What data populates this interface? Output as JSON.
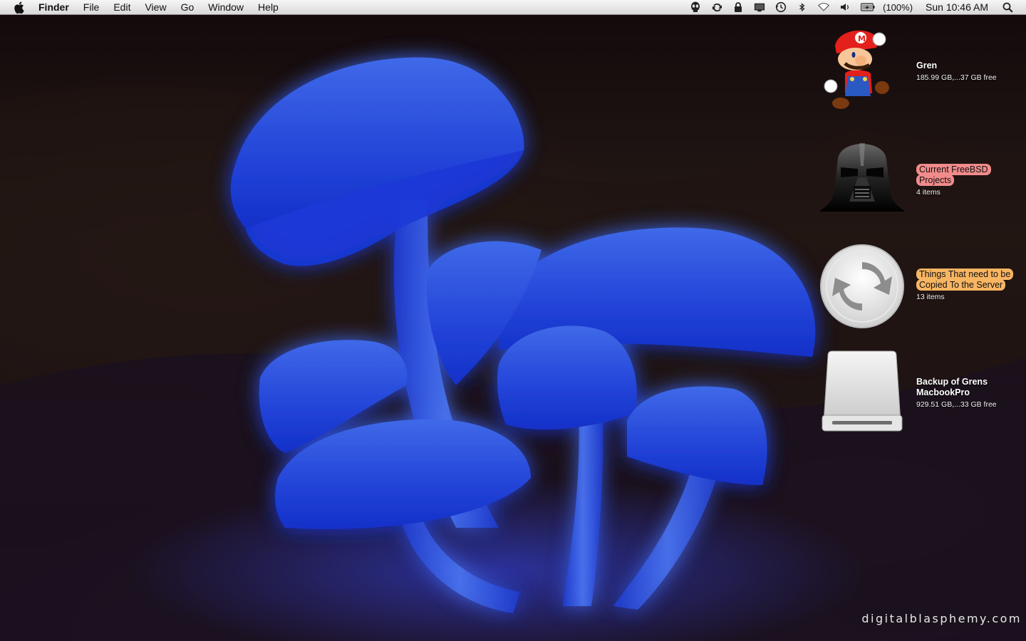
{
  "menubar": {
    "apple_icon": "apple-logo-icon",
    "app_name": "Finder",
    "menus": [
      "File",
      "Edit",
      "View",
      "Go",
      "Window",
      "Help"
    ],
    "status_icons": [
      "alien-icon",
      "sync-icon",
      "lock-icon",
      "display-icon",
      "time-machine-icon",
      "bluetooth-icon",
      "wifi-icon",
      "volume-icon",
      "battery-icon"
    ],
    "battery_percent": "(100%)",
    "clock": "Sun 10:46 AM",
    "spotlight_icon": "magnifier-icon"
  },
  "desktop": {
    "items": [
      {
        "name": "Gren",
        "detail": "185.99 GB,...37 GB free",
        "icon": "mario-icon",
        "label_color": ""
      },
      {
        "name": "Current FreeBSD Projects",
        "detail": "4 items",
        "icon": "darth-vader-icon",
        "label_color": "#f28b8b"
      },
      {
        "name": "Things That need to be Copied To the Server",
        "detail": "13 items",
        "icon": "sync-folder-icon",
        "label_color": "#f8b562"
      },
      {
        "name": "Backup of Grens MacbookPro",
        "detail": "929.51 GB,...33 GB free",
        "icon": "external-drive-icon",
        "label_color": ""
      }
    ]
  },
  "wallpaper": {
    "watermark": "digitalblasphemy.com",
    "glow_color": "#2b4cff"
  }
}
